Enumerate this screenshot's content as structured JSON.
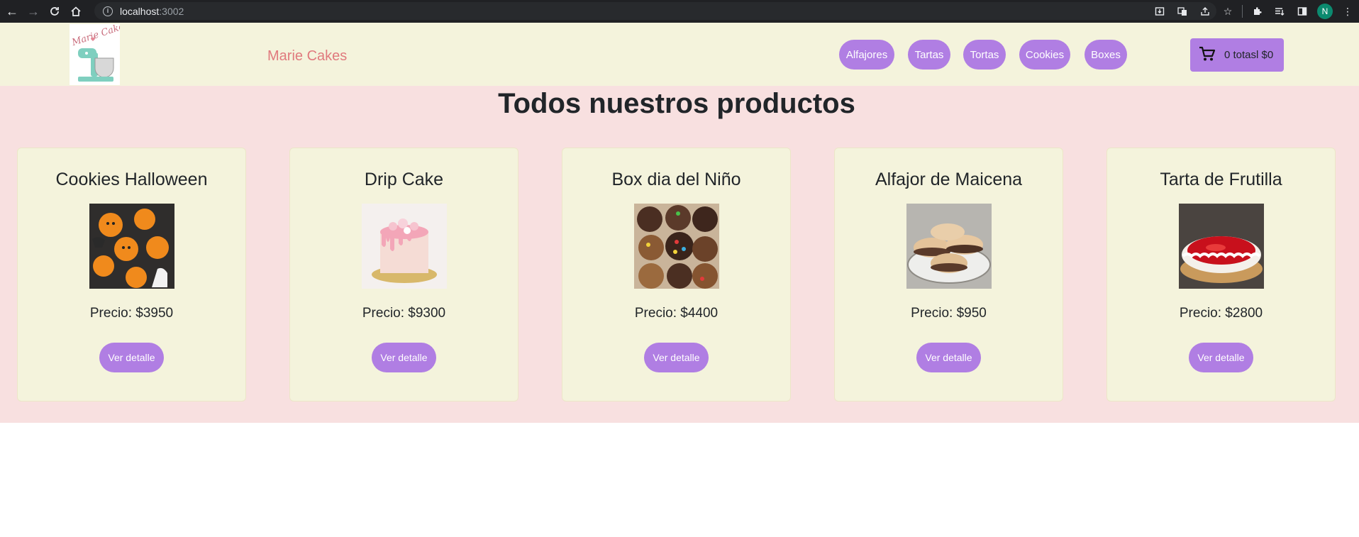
{
  "browser": {
    "url_host": "localhost",
    "url_port": ":3002",
    "profile_initial": "N"
  },
  "header": {
    "brand": "Marie Cakes",
    "logo_text": "Marie Cakes",
    "categories": [
      "Alfajores",
      "Tartas",
      "Tortas",
      "Cookies",
      "Boxes"
    ],
    "cart_label": "0 totasl $0",
    "accent_color": "#b07ee3"
  },
  "main": {
    "title": "Todos nuestros productos",
    "products": [
      {
        "name": "Cookies Halloween",
        "price": "Precio: $3950",
        "button": "Ver detalle"
      },
      {
        "name": "Drip Cake",
        "price": "Precio: $9300",
        "button": "Ver detalle"
      },
      {
        "name": "Box dia del Niño",
        "price": "Precio: $4400",
        "button": "Ver detalle"
      },
      {
        "name": "Alfajor de Maicena",
        "price": "Precio: $950",
        "button": "Ver detalle"
      },
      {
        "name": "Tarta de Frutilla",
        "price": "Precio: $2800",
        "button": "Ver detalle"
      }
    ]
  }
}
